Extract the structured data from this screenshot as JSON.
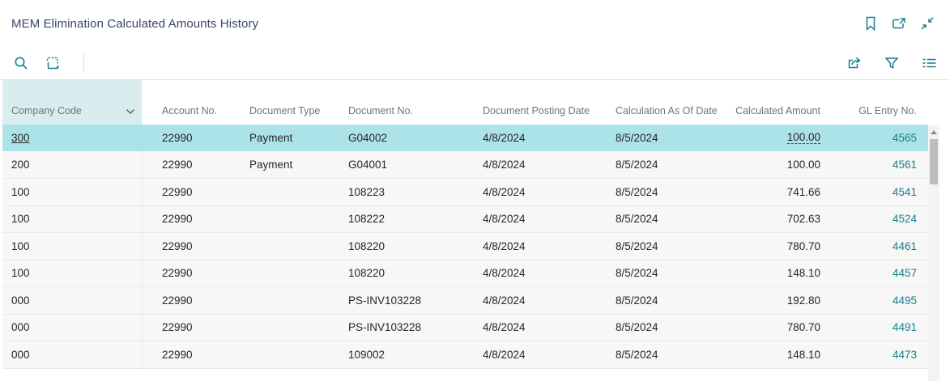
{
  "window": {
    "title": "MEM Elimination Calculated Amounts History"
  },
  "icons": {
    "titlebar": [
      "bookmark",
      "open-in-new-window",
      "collapse"
    ],
    "toolbar_left": [
      "search",
      "analyze"
    ],
    "toolbar_right": [
      "share",
      "filter",
      "list-options"
    ]
  },
  "colors": {
    "accent_teal": "#17808E",
    "selected_row_bg": "#ACE3E9",
    "highlighted_column_bg": "#D9EDEE",
    "link": "#17808E",
    "title_text": "#394764"
  },
  "table": {
    "columns": [
      {
        "label": "Company Code",
        "has_dropdown": true
      },
      {
        "label": "Account No."
      },
      {
        "label": "Document Type"
      },
      {
        "label": "Document No."
      },
      {
        "label": "Document Posting Date"
      },
      {
        "label": "Calculation As Of Date"
      },
      {
        "label": "Calculated Amount"
      },
      {
        "label": "GL Entry No."
      }
    ],
    "rows": [
      {
        "values": [
          "300",
          "22990",
          "Payment",
          "G04002",
          "4/8/2024",
          "8/5/2024",
          "100.00",
          "4565"
        ],
        "selected": true
      },
      {
        "values": [
          "200",
          "22990",
          "Payment",
          "G04001",
          "4/8/2024",
          "8/5/2024",
          "100.00",
          "4561"
        ],
        "selected": false
      },
      {
        "values": [
          "100",
          "22990",
          "",
          "108223",
          "4/8/2024",
          "8/5/2024",
          "741.66",
          "4541"
        ],
        "selected": false
      },
      {
        "values": [
          "100",
          "22990",
          "",
          "108222",
          "4/8/2024",
          "8/5/2024",
          "702.63",
          "4524"
        ],
        "selected": false
      },
      {
        "values": [
          "100",
          "22990",
          "",
          "108220",
          "4/8/2024",
          "8/5/2024",
          "780.70",
          "4461"
        ],
        "selected": false
      },
      {
        "values": [
          "100",
          "22990",
          "",
          "108220",
          "4/8/2024",
          "8/5/2024",
          "148.10",
          "4457"
        ],
        "selected": false
      },
      {
        "values": [
          "000",
          "22990",
          "",
          "PS-INV103228",
          "4/8/2024",
          "8/5/2024",
          "192.80",
          "4495"
        ],
        "selected": false
      },
      {
        "values": [
          "000",
          "22990",
          "",
          "PS-INV103228",
          "4/8/2024",
          "8/5/2024",
          "780.70",
          "4491"
        ],
        "selected": false
      },
      {
        "values": [
          "000",
          "22990",
          "",
          "109002",
          "4/8/2024",
          "8/5/2024",
          "148.10",
          "4473"
        ],
        "selected": false
      }
    ]
  }
}
